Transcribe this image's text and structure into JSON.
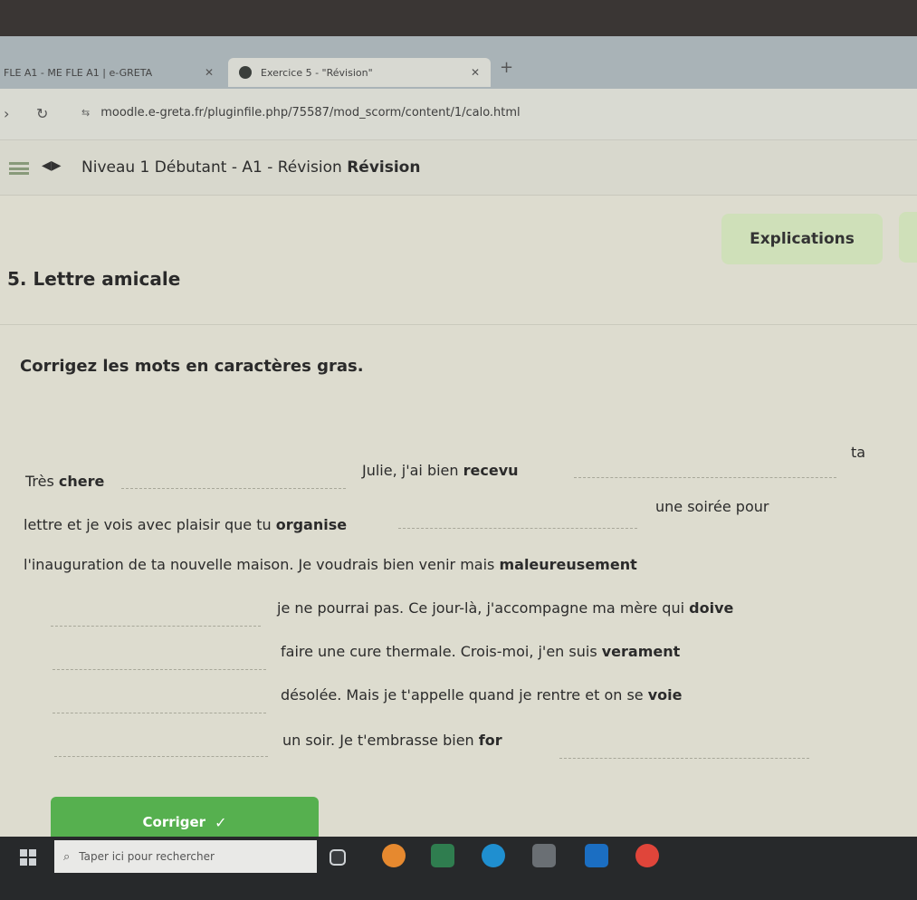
{
  "browser": {
    "tabs": [
      {
        "label": "FLE A1 - ME FLE A1 | e-GRETA"
      },
      {
        "label": "Exercice 5 - \"Révision\""
      }
    ],
    "url": "moodle.e-greta.fr/pluginfile.php/75587/mod_scorm/content/1/calo.html"
  },
  "header": {
    "title": "Niveau 1 Débutant - A1 - Révision",
    "title_bold": "Révision"
  },
  "main": {
    "explications_label": "Explications",
    "section_title": "5. Lettre amicale",
    "instruction": "Corrigez les mots en caractères gras.",
    "line1": {
      "prefix": "Très ",
      "bold1": "chere",
      "middle": "Julie, j'ai bien ",
      "bold2": "recevu",
      "suffix": "ta"
    },
    "line2": {
      "prefix": "lettre et je vois avec plaisir que tu ",
      "bold": "organise",
      "suffix": "une soirée pour"
    },
    "line3": {
      "prefix": "l'inauguration de ta nouvelle maison. Je voudrais bien venir mais ",
      "bold": "maleureusement"
    },
    "line4": {
      "prefix": "je ne pourrai pas. Ce jour-là, j'accompagne ma mère qui ",
      "bold": "doive"
    },
    "line5": {
      "prefix": "faire une cure thermale. Crois-moi, j'en suis ",
      "bold": "verament"
    },
    "line6": {
      "prefix": "désolée. Mais je t'appelle quand je rentre et on se ",
      "bold": "voie"
    },
    "line7": {
      "prefix": "un soir. Je t'embrasse bien ",
      "bold": "for",
      "suffix": "."
    },
    "corriger_label": "Corriger",
    "check_icon": "✓"
  },
  "taskbar": {
    "search_placeholder": "Taper ici pour rechercher"
  },
  "colors": {
    "button_green": "#56b04f",
    "explications_bg": "#cfe0b9"
  }
}
